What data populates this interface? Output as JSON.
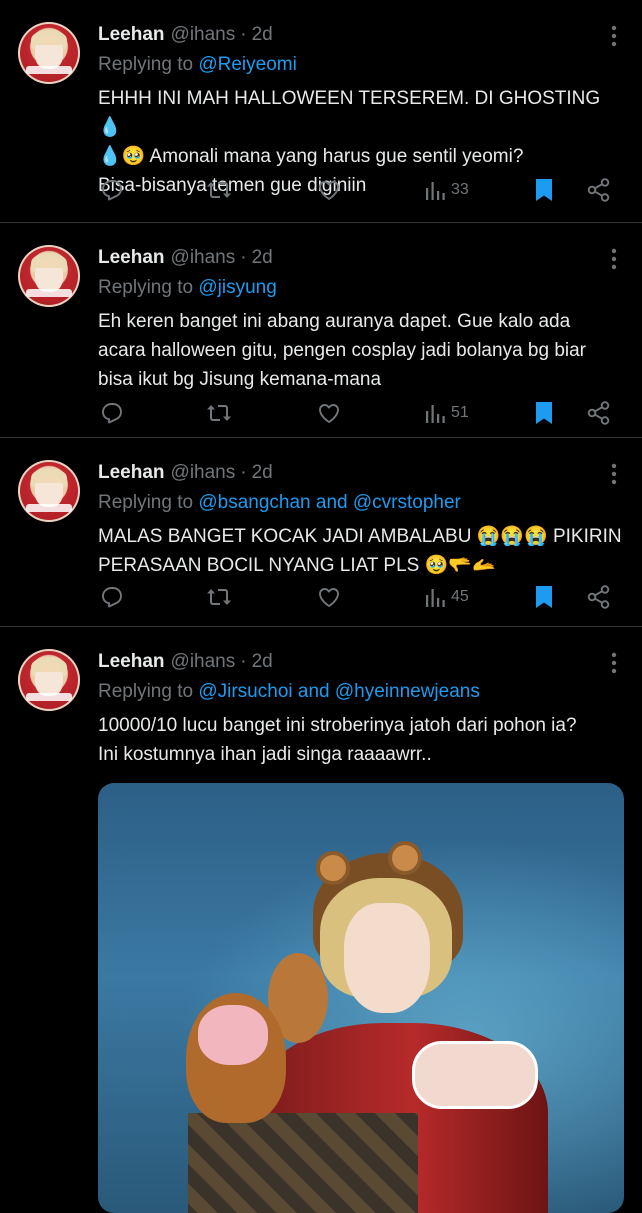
{
  "tweets": [
    {
      "name": "Leehan",
      "handle": "@ihans",
      "separator": "·",
      "time": "2d",
      "replying_prefix": "Replying to",
      "replying_to": "@Reiyeomi",
      "text": "EHHH INI MAH HALLOWEEN TERSEREM. DI GHOSTING 💧\n💧🥹 Amonali mana yang harus gue sentil yeomi?\nBisa-bisanya temen gue diginiin",
      "views": "33"
    },
    {
      "name": "Leehan",
      "handle": "@ihans",
      "separator": "·",
      "time": "2d",
      "replying_prefix": "Replying to",
      "replying_to": "@jisyung",
      "text": "Eh keren banget ini abang auranya dapet. Gue kalo ada\nacara halloween gitu, pengen cosplay jadi bolanya bg biar\nbisa ikut bg Jisung kemana-mana",
      "views": "51"
    },
    {
      "name": "Leehan",
      "handle": "@ihans",
      "separator": "·",
      "time": "2d",
      "replying_prefix": "Replying to",
      "replying_to": "@bsangchan and @cvrstopher",
      "text": "MALAS BANGET KOCAK JADI AMBALABU 😭😭😭 PIKIRIN\nPERASAAN BOCIL NYANG LIAT PLS 🥹🫳🫴",
      "views": "45"
    },
    {
      "name": "Leehan",
      "handle": "@ihans",
      "separator": "·",
      "time": "2d",
      "replying_prefix": "Replying to",
      "replying_to": "@Jirsuchoi and @hyeinnewjeans",
      "text": "10000/10 lucu banget ini stroberinya jatoh dari pohon ia?\nIni kostumnya ihan jadi singa raaaawrr..",
      "has_media": true
    }
  ],
  "colors": {
    "background": "#000000",
    "text": "#e7e9ea",
    "muted": "#71767b",
    "accent": "#1d9bf0",
    "divider": "#2f3336"
  },
  "icons": [
    "more-icon",
    "reply-icon",
    "retweet-icon",
    "like-icon",
    "views-icon",
    "bookmark-icon",
    "share-icon"
  ]
}
